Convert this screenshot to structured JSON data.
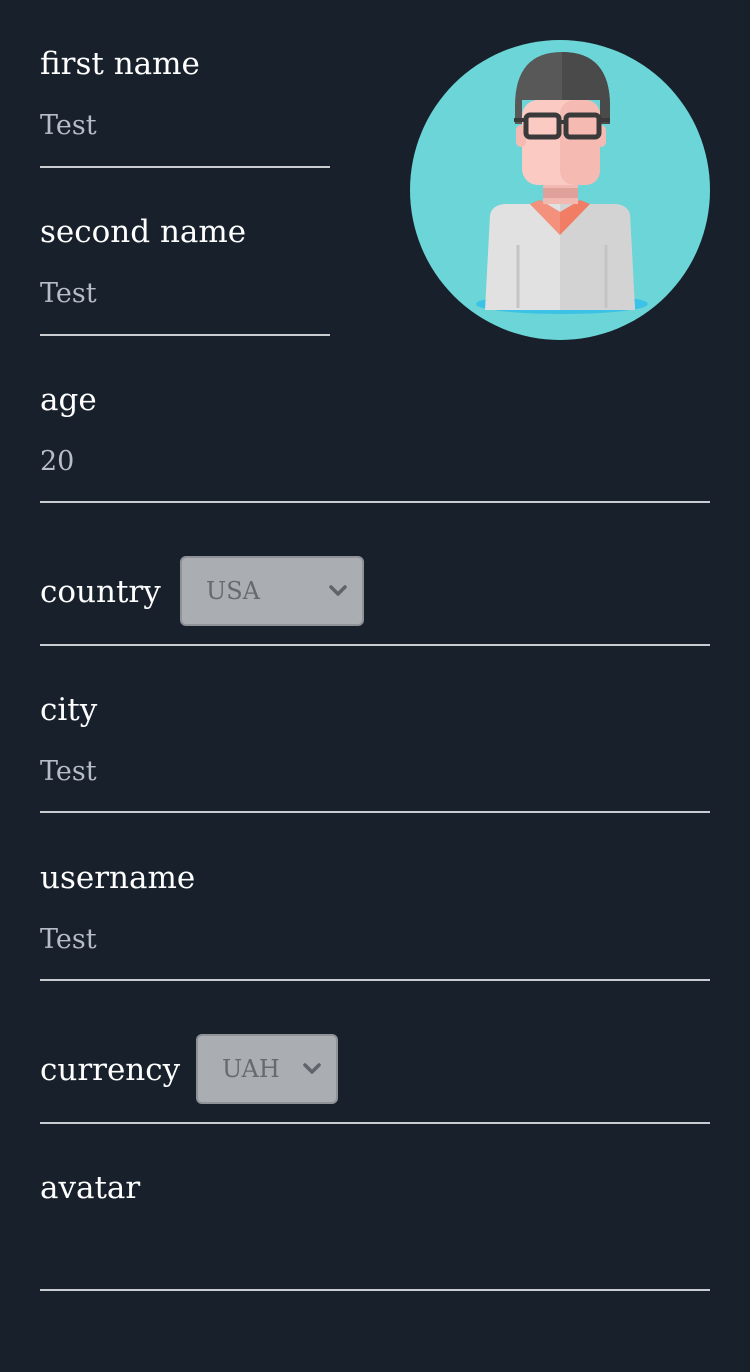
{
  "form": {
    "first_name": {
      "label": "first name",
      "value": "Test"
    },
    "second_name": {
      "label": "second name",
      "value": "Test"
    },
    "age": {
      "label": "age",
      "value": "20"
    },
    "country": {
      "label": "country",
      "selected": "USA"
    },
    "city": {
      "label": "city",
      "value": "Test"
    },
    "username": {
      "label": "username",
      "value": "Test"
    },
    "currency": {
      "label": "currency",
      "selected": "UAH"
    },
    "avatar": {
      "label": "avatar"
    }
  },
  "icons": {
    "profile_avatar": "avatar-icon",
    "dropdown": "chevron-down-icon"
  },
  "colors": {
    "background": "#17202b",
    "avatar_circle": "#6bd5d7",
    "select_bg": "#aaadb2"
  }
}
